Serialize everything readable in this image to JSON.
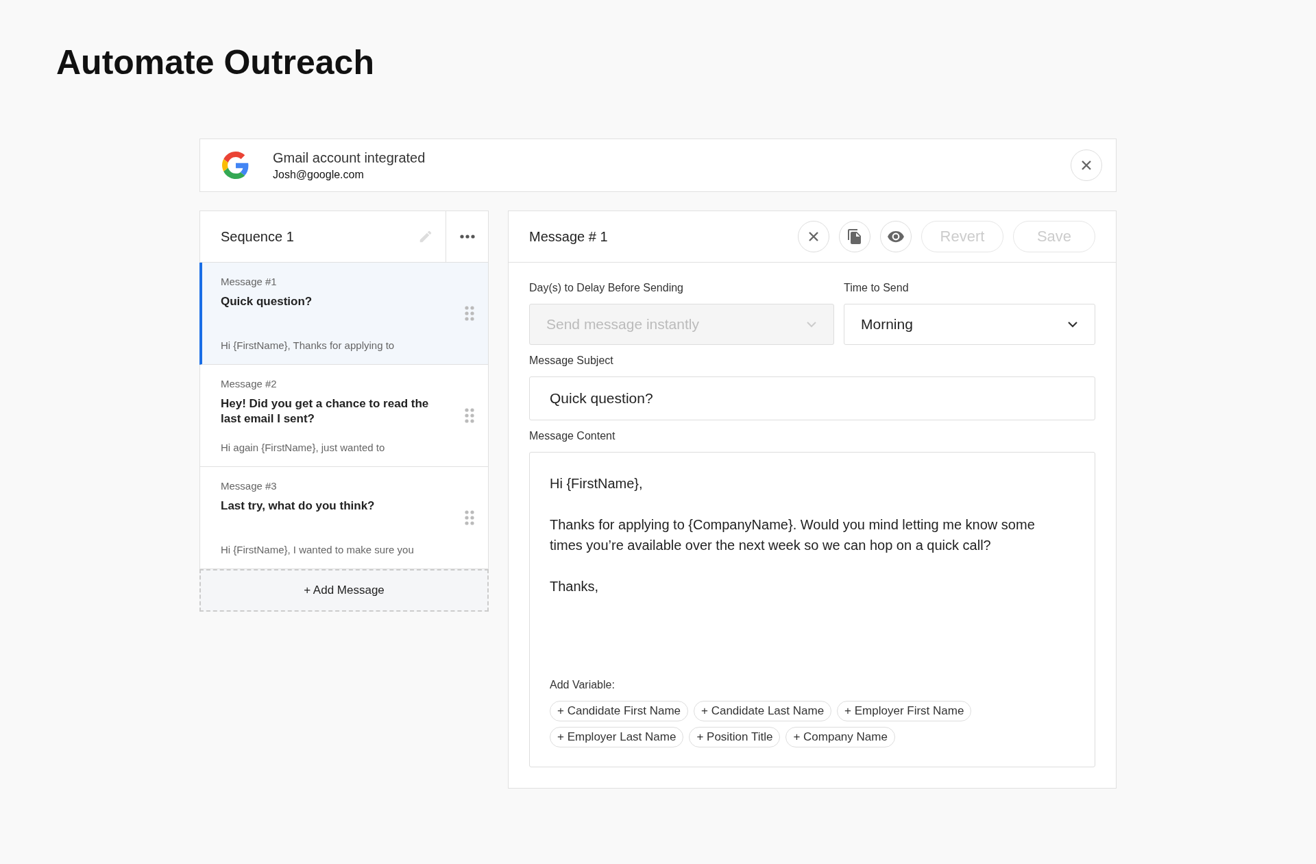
{
  "page_title": "Automate Outreach",
  "account": {
    "title": "Gmail account integrated",
    "email": "Josh@google.com"
  },
  "sequence": {
    "title": "Sequence 1",
    "messages": [
      {
        "label": "Message #1",
        "subject": "Quick question?",
        "preview": "Hi {FirstName}, Thanks for applying to",
        "selected": true
      },
      {
        "label": "Message #2",
        "subject": "Hey! Did you get a chance to read the last email I sent?",
        "preview": "Hi again {FirstName}, just wanted to",
        "selected": false
      },
      {
        "label": "Message #3",
        "subject": "Last try, what do you think?",
        "preview": "Hi {FirstName}, I wanted to make sure you",
        "selected": false
      }
    ],
    "add_button": "+ Add Message"
  },
  "editor": {
    "title": "Message # 1",
    "buttons": [
      {
        "label": "Revert",
        "disabled": true
      },
      {
        "label": "Save",
        "disabled": true
      }
    ],
    "delay": {
      "label": "Day(s) to Delay Before Sending",
      "placeholder": "Send message instantly",
      "disabled": true
    },
    "time": {
      "label": "Time to Send",
      "value": "Morning",
      "disabled": false
    },
    "subject": {
      "label": "Message Subject",
      "value": "Quick question?"
    },
    "content": {
      "label": "Message Content",
      "paragraphs": [
        "Hi {FirstName},",
        "Thanks for applying to {CompanyName}. Would you mind letting me know some times you’re available over the next week so we can hop on a quick call?",
        "Thanks,"
      ]
    },
    "variables_label": "Add Variable:",
    "variables": [
      "+ Candidate First Name",
      "+ Candidate Last Name",
      "+ Employer First Name",
      "+ Employer Last Name",
      "+ Position Title",
      "+ Company Name"
    ]
  }
}
